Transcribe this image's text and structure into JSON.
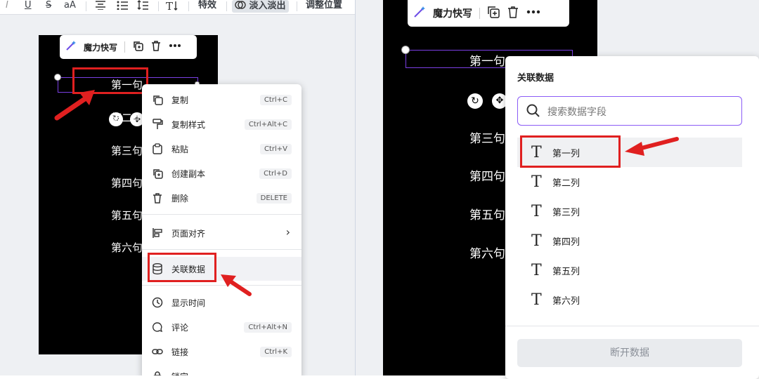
{
  "toolbar": {
    "italic": "I",
    "underline": "U",
    "strike": "S",
    "case": "aA",
    "effects": "特效",
    "fade_inout": "淡入淡出",
    "adjust_position": "调整位置"
  },
  "mini_toolbar": {
    "magic_write": "魔力快写"
  },
  "canvas_lines": [
    "第一句",
    "第二句",
    "第三句",
    "第四句",
    "第五句",
    "第六句"
  ],
  "context_menu": {
    "items": [
      {
        "label": "复制",
        "shortcut": "Ctrl+C",
        "icon": "copy-icon"
      },
      {
        "label": "复制样式",
        "shortcut": "Ctrl+Alt+C",
        "icon": "paint-roller-icon"
      },
      {
        "label": "粘贴",
        "shortcut": "Ctrl+V",
        "icon": "clipboard-icon"
      },
      {
        "label": "创建副本",
        "shortcut": "Ctrl+D",
        "icon": "duplicate-icon"
      },
      {
        "label": "删除",
        "shortcut": "DELETE",
        "icon": "trash-icon"
      },
      {
        "label": "页面对齐",
        "shortcut": "",
        "icon": "align-icon"
      },
      {
        "label": "关联数据",
        "shortcut": "",
        "icon": "database-icon"
      },
      {
        "label": "显示时间",
        "shortcut": "",
        "icon": "clock-icon"
      },
      {
        "label": "评论",
        "shortcut": "Ctrl+Alt+N",
        "icon": "comment-icon"
      },
      {
        "label": "链接",
        "shortcut": "Ctrl+K",
        "icon": "link-icon"
      },
      {
        "label": "锁定",
        "shortcut": "",
        "icon": "lock-icon"
      }
    ]
  },
  "data_panel": {
    "title": "关联数据",
    "search_placeholder": "搜索数据字段",
    "fields": [
      "第一列",
      "第二列",
      "第三列",
      "第四列",
      "第五列",
      "第六列"
    ],
    "disconnect": "断开数据"
  },
  "colors": {
    "accent": "#8b5cf6",
    "selection": "#7b3fe4",
    "highlight": "#e02020",
    "canvas": "#000000"
  }
}
